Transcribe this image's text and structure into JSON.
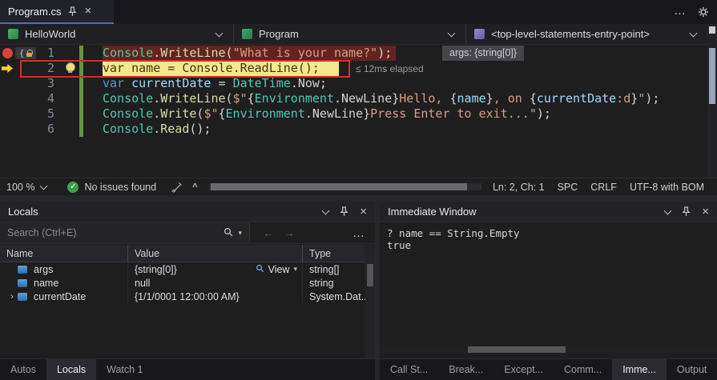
{
  "colors": {
    "accent_blue": "#4d6bbd",
    "breakpoint_red": "#e1413c",
    "change_bar_green": "#64943c",
    "current_line_yellow": "#f2e98f",
    "annotation_red": "#d03028",
    "check_green": "#3ba04a"
  },
  "icons": {
    "close": "×",
    "menu_dots": "…",
    "back_arrow": "←",
    "forward_arrow": "→",
    "check": "✓",
    "caret_up": "^",
    "dropdown_arrow": "▾",
    "brace_badge": "{"
  },
  "tab_bar": {
    "tab_title": "Program.cs"
  },
  "nav_bar": {
    "project": "HelloWorld",
    "type": "Program",
    "member": "<top-level-statements-entry-point>"
  },
  "editor": {
    "datatip": "args: {string[0]}",
    "perftip": "≤ 12ms elapsed",
    "lines": [
      {
        "num": "1",
        "kind": "breakpoint",
        "tokens": [
          [
            "Console",
            "cls"
          ],
          [
            ".",
            "pn"
          ],
          [
            "WriteLine",
            "mth"
          ],
          [
            "(",
            "pn"
          ],
          [
            "\"What is your name?\"",
            "str"
          ],
          [
            ");",
            "pn"
          ]
        ]
      },
      {
        "num": "2",
        "kind": "current",
        "tokens": [
          [
            "var",
            "kw"
          ],
          [
            " ",
            "pn"
          ],
          [
            "name",
            "loc"
          ],
          [
            " = ",
            "pn"
          ],
          [
            "Console",
            "cls"
          ],
          [
            ".",
            "pn"
          ],
          [
            "ReadLine",
            "mth"
          ],
          [
            "();",
            "pn"
          ]
        ]
      },
      {
        "num": "3",
        "kind": "plain",
        "tokens": [
          [
            "var",
            "kw"
          ],
          [
            " ",
            "pn"
          ],
          [
            "currentDate",
            "loc"
          ],
          [
            " = ",
            "pn"
          ],
          [
            "DateTime",
            "cls"
          ],
          [
            ".",
            "pn"
          ],
          [
            "Now",
            "pn"
          ],
          [
            ";",
            "pn"
          ]
        ]
      },
      {
        "num": "4",
        "kind": "plain",
        "tokens": [
          [
            "Console",
            "cls"
          ],
          [
            ".",
            "pn"
          ],
          [
            "WriteLine",
            "mth"
          ],
          [
            "(",
            "pn"
          ],
          [
            "$\"",
            "str"
          ],
          [
            "{",
            "pn"
          ],
          [
            "Environment",
            "cls"
          ],
          [
            ".",
            "pn"
          ],
          [
            "NewLine",
            "pn"
          ],
          [
            "}",
            "pn"
          ],
          [
            "Hello, ",
            "str"
          ],
          [
            "{",
            "pn"
          ],
          [
            "name",
            "loc"
          ],
          [
            "}",
            "pn"
          ],
          [
            ", on ",
            "str"
          ],
          [
            "{",
            "pn"
          ],
          [
            "currentDate",
            "loc"
          ],
          [
            ":d",
            "str"
          ],
          [
            "}",
            "pn"
          ],
          [
            "\"",
            "str"
          ],
          [
            ");",
            "pn"
          ]
        ]
      },
      {
        "num": "5",
        "kind": "plain",
        "tokens": [
          [
            "Console",
            "cls"
          ],
          [
            ".",
            "pn"
          ],
          [
            "Write",
            "mth"
          ],
          [
            "(",
            "pn"
          ],
          [
            "$\"",
            "str"
          ],
          [
            "{",
            "pn"
          ],
          [
            "Environment",
            "cls"
          ],
          [
            ".",
            "pn"
          ],
          [
            "NewLine",
            "pn"
          ],
          [
            "}",
            "pn"
          ],
          [
            "Press Enter to exit...",
            "str"
          ],
          [
            "\"",
            "str"
          ],
          [
            ");",
            "pn"
          ]
        ]
      },
      {
        "num": "6",
        "kind": "plain",
        "tokens": [
          [
            "Console",
            "cls"
          ],
          [
            ".",
            "pn"
          ],
          [
            "Read",
            "mth"
          ],
          [
            "();",
            "pn"
          ]
        ]
      }
    ]
  },
  "status_bar": {
    "zoom": "100 %",
    "issues": "No issues found",
    "line_col": "Ln: 2, Ch: 1",
    "insert_mode": "SPC",
    "line_ending": "CRLF",
    "encoding": "UTF-8 with BOM"
  },
  "locals_panel": {
    "title": "Locals",
    "search_placeholder": "Search (Ctrl+E)",
    "columns": [
      "Name",
      "Value",
      "Type"
    ],
    "rows": [
      {
        "expander": "",
        "name": "args",
        "value": "{string[0]}",
        "action": "View",
        "type": "string[]"
      },
      {
        "expander": "",
        "name": "name",
        "value": "null",
        "action": "",
        "type": "string"
      },
      {
        "expander": "›",
        "name": "currentDate",
        "value": "{1/1/0001 12:00:00 AM}",
        "action": "",
        "type": "System.Dat..."
      }
    ],
    "tabs": [
      {
        "label": "Autos",
        "active": false
      },
      {
        "label": "Locals",
        "active": true
      },
      {
        "label": "Watch 1",
        "active": false
      }
    ]
  },
  "immediate_panel": {
    "title": "Immediate Window",
    "lines": [
      "? name == String.Empty",
      "true"
    ],
    "tabs": [
      {
        "label": "Call St...",
        "active": false
      },
      {
        "label": "Break...",
        "active": false
      },
      {
        "label": "Except...",
        "active": false
      },
      {
        "label": "Comm...",
        "active": false
      },
      {
        "label": "Imme...",
        "active": true
      },
      {
        "label": "Output",
        "active": false
      }
    ]
  }
}
